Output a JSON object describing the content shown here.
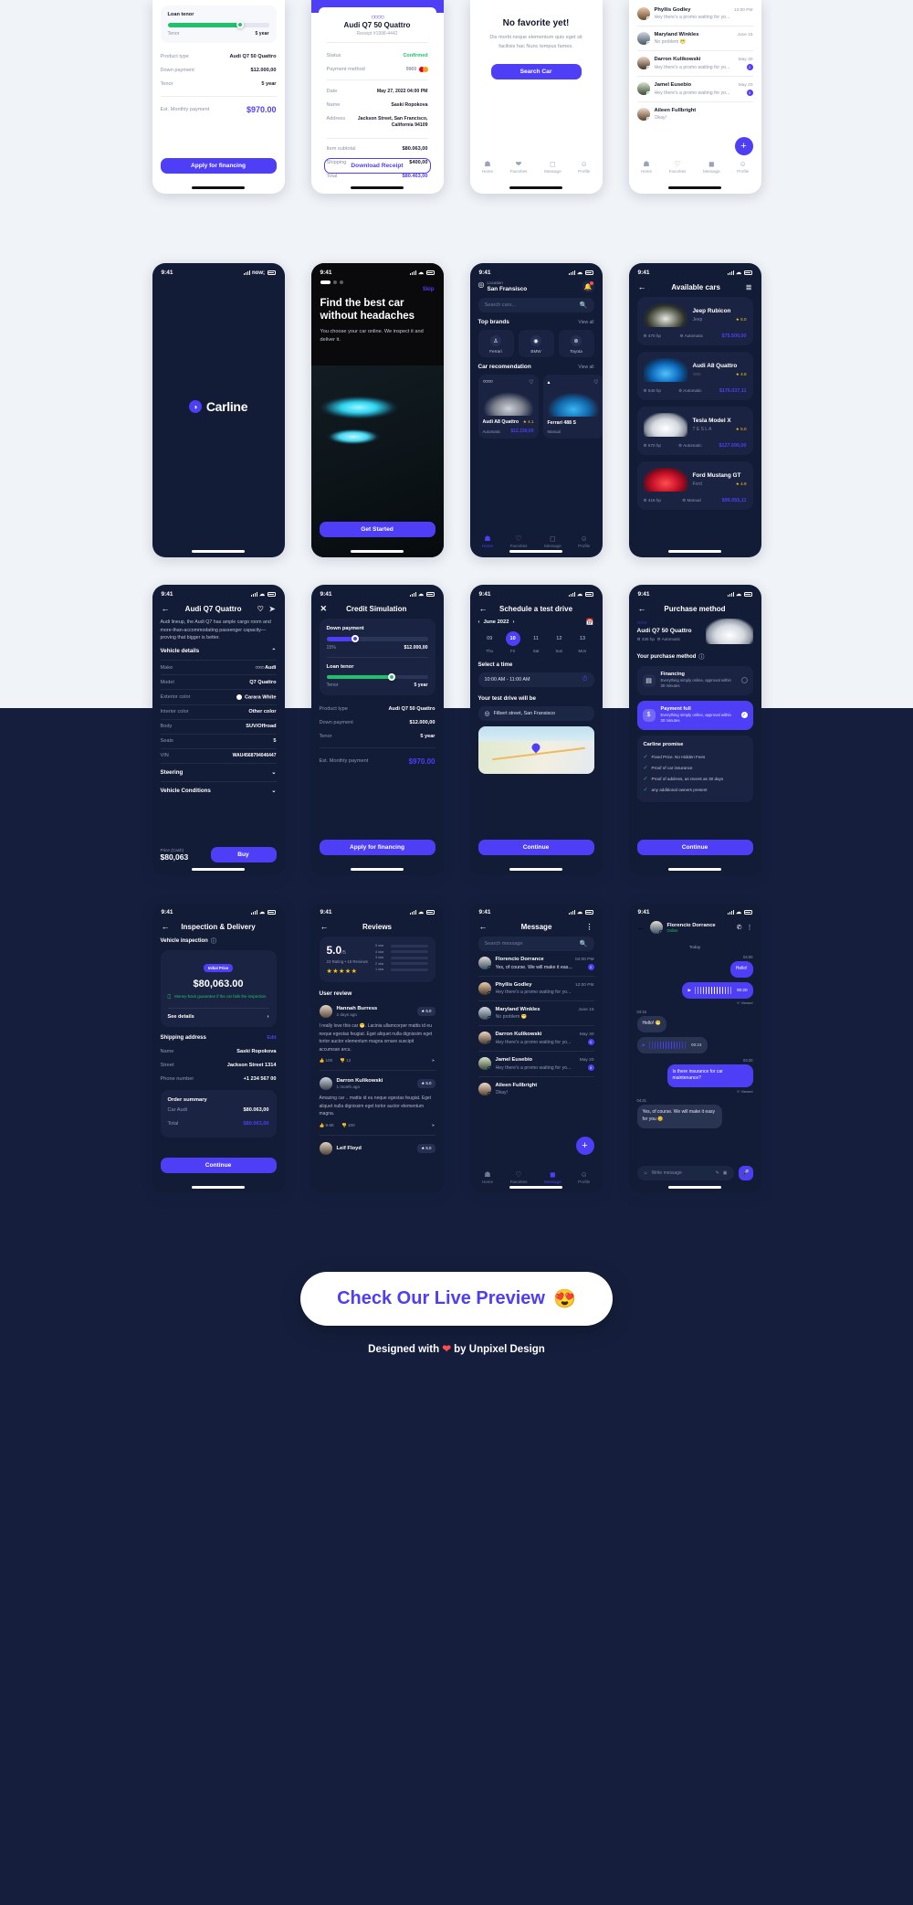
{
  "meta": {
    "status_time": "9:41"
  },
  "brand": {
    "name": "Carline",
    "accent": "#4e3ef5",
    "green": "#1fc16b",
    "gold": "#f5c518"
  },
  "financing": {
    "loan_tenor_label": "Loan tenor",
    "tenor_label": "Tenor",
    "tenor_value": "5 year",
    "rows": [
      {
        "k": "Product type",
        "v": "Audi Q7 50 Quattro"
      },
      {
        "k": "Down payment",
        "v": "$12.000,00"
      },
      {
        "k": "Tenor",
        "v": "5 year"
      }
    ],
    "est_label": "Est. Monthly payment",
    "est_value": "$970.00",
    "cta": "Apply for financing"
  },
  "receipt": {
    "brand_glyph": "\u0000",
    "title": "Audi Q7 50 Quattro",
    "receipt_no": "Receipt #1998-4442",
    "status_label": "Status",
    "status_value": "Confirmed",
    "payment_label": "Payment method",
    "payment_value": "9969",
    "rows": [
      {
        "k": "Date",
        "v": "May 27, 2022 04:00 PM"
      },
      {
        "k": "Name",
        "v": "Saski Ropokova"
      },
      {
        "k": "Address",
        "v": "Jackson Street, San Francisco, California 94109"
      }
    ],
    "totals": [
      {
        "k": "Item subtotal",
        "v": "$80.063,00"
      },
      {
        "k": "Shipping",
        "v": "$400,00"
      },
      {
        "k": "Total",
        "v": "$80.463,00"
      }
    ],
    "cta": "Download Receipt"
  },
  "favorites_empty": {
    "title": "No favorite yet!",
    "body": "Dis morbi neque elementum quis eget sit facilisis hac Nunc tempus fames.",
    "cta": "Search Car"
  },
  "tabbar": {
    "home": "Home",
    "favorites": "Favorites",
    "message": "Message",
    "profile": "Profile"
  },
  "messages": {
    "title": "Message",
    "search_placeholder": "Search message",
    "items": [
      {
        "name": "Florencio Dorrance",
        "time": "04:00 PM",
        "preview": "Yes, of course. We will make it eas...",
        "badge": "2"
      },
      {
        "name": "Phyllis Godley",
        "time": "12:00 PM",
        "preview": "Hey there's a promo waiting for yo...",
        "badge": ""
      },
      {
        "name": "Maryland Winkles",
        "time": "June 15",
        "preview": "No problem 😁",
        "badge": ""
      },
      {
        "name": "Darron Kulikowski",
        "time": "May 30",
        "preview": "Hey there's a promo waiting for yo...",
        "badge": "2"
      },
      {
        "name": "Jamel Eusebio",
        "time": "May 20",
        "preview": "Hey there's a promo waiting for yo...",
        "badge": "3"
      },
      {
        "name": "Aileen Fullbright",
        "time": "",
        "preview": "Okay!",
        "badge": ""
      }
    ],
    "fab": "+"
  },
  "splash": {
    "brand": "Carline",
    "logo_glyph": "◔"
  },
  "onboarding": {
    "skip": "Skip",
    "headline": "Find the best car without headaches",
    "body": "You choose your car online. We inspect it and deliver it.",
    "cta": "Get Started"
  },
  "home": {
    "location_caption": "Location",
    "location_value": "San Fransisco",
    "search_placeholder": "Search cars...",
    "top_brands_title": "Top brands",
    "view_all": "View all",
    "brands": [
      {
        "name": "Ferrari",
        "glyph": "♙"
      },
      {
        "name": "BMW",
        "glyph": "◉"
      },
      {
        "name": "Toyota",
        "glyph": "⊚"
      }
    ],
    "recommendation_title": "Car recomendation",
    "cars": [
      {
        "name": "Audi A8 Quattro",
        "rating": "4.1",
        "transmission": "Automatic",
        "price": "$12.150,00"
      },
      {
        "name": "Ferrari 488 S",
        "rating": "",
        "transmission": "Manual",
        "price": ""
      }
    ]
  },
  "available": {
    "title": "Available cars",
    "cars": [
      {
        "name": "Jeep Rubicon",
        "brand": "Jeep",
        "rating": "5.0",
        "hp": "470 hp",
        "transmission": "Automatic",
        "price": "$75.500,00",
        "thumb": "t-jeep"
      },
      {
        "name": "Audi A8 Quattro",
        "brand": "ⒶⒶⒶⒶ",
        "rating": "4.8",
        "hp": "540 hp",
        "transmission": "Automatic",
        "price": "$176.037,11",
        "thumb": "t-audi"
      },
      {
        "name": "Tesla Model X",
        "brand": "T E S L A",
        "rating": "5.0",
        "hp": "670 hp",
        "transmission": "Automatic",
        "price": "$127.690,00",
        "thumb": "t-tesla"
      },
      {
        "name": "Ford Mustang GT",
        "brand": "Ford",
        "rating": "4.9",
        "hp": "416 hp",
        "transmission": "Manual",
        "price": "$96.055,11",
        "thumb": "t-ford"
      }
    ]
  },
  "detail": {
    "title": "Audi Q7 Quattro",
    "description": "Audi lineup, the Audi Q7 has ample cargo room and more-than-accommodating passenger capacity—proving that bigger is better.",
    "section_vehicle_details": "Vehicle details",
    "specs": [
      {
        "k": "Make",
        "v": "Audi"
      },
      {
        "k": "Model",
        "v": "Q7 Quattro"
      },
      {
        "k": "Exterior color",
        "v": "Carara White"
      },
      {
        "k": "Interior color",
        "v": "Other color"
      },
      {
        "k": "Body",
        "v": "SUV/Offroad"
      },
      {
        "k": "Seats",
        "v": "5"
      },
      {
        "k": "VIN",
        "v": "WAU4568794046447"
      }
    ],
    "section_steering": "Steering",
    "section_conditions": "Vehicle Conditions",
    "price_label": "Price (Cash)",
    "price_value": "$80,063",
    "cta": "Buy"
  },
  "credit": {
    "title": "Credit Simulation",
    "down_payment_label": "Down payment",
    "down_payment_min": "15%",
    "down_payment_value": "$12.000,00",
    "loan_tenor_label": "Loan tenor",
    "tenor_label": "Tenor",
    "tenor_value": "5 year",
    "rows": [
      {
        "k": "Product type",
        "v": "Audi Q7 50 Quattro"
      },
      {
        "k": "Down payment",
        "v": "$12.000,00"
      },
      {
        "k": "Tenor",
        "v": "5 year"
      }
    ],
    "est_label": "Est. Monthly payment",
    "est_value": "$970.00",
    "cta": "Apply for financing"
  },
  "schedule": {
    "title": "Schedule a test drive",
    "month": "June 2022",
    "days": [
      {
        "n": "09",
        "w": "Thu",
        "sel": false
      },
      {
        "n": "10",
        "w": "Fri",
        "sel": true
      },
      {
        "n": "11",
        "w": "Sat",
        "sel": false
      },
      {
        "n": "12",
        "w": "Sun",
        "sel": false
      },
      {
        "n": "13",
        "w": "Mon",
        "sel": false
      }
    ],
    "select_time_label": "Select a time",
    "time_value": "10:00 AM - 11:00 AM",
    "test_drive_label": "Your test drive will be",
    "location_value": "Filbert street, San Fransisco",
    "cta": "Continue"
  },
  "purchase": {
    "title": "Purchase method",
    "car_name": "Audi Q7 50 Quattro",
    "car_hp": "335 hp",
    "car_transmission": "Automatic",
    "method_label": "Your purchase method",
    "options": [
      {
        "t": "Financing",
        "d": "Everything simply online, approval within 30 minutes",
        "sel": false,
        "glyph": "▤"
      },
      {
        "t": "Payment full",
        "d": "Everything simply online, approval within 30 minutes",
        "sel": true,
        "glyph": "$"
      }
    ],
    "promise_title": "Carline promise",
    "promises": [
      "Fixed Price. No Hidden Fees",
      "Proof of car insurance",
      "Proof of address, as recent as 30 days",
      "any additional owners present"
    ],
    "cta": "Continue"
  },
  "inspection": {
    "title": "Inspection & Delivery",
    "section_label": "Vehicle inspection",
    "tag": "Initial Price",
    "amount": "$80,063.00",
    "guarantee": "Money-back guarantee if the car fails the inspection",
    "see_details": "See details",
    "shipping_label": "Shipping address",
    "edit": "Edit",
    "address": [
      {
        "k": "Name",
        "v": "Saski Ropokova"
      },
      {
        "k": "Street",
        "v": "Jackson Street 1314"
      },
      {
        "k": "Phone number",
        "v": "+1 234 567 00"
      }
    ],
    "summary_title": "Order summary",
    "summary": [
      {
        "k": "Car Audi",
        "v": "$80.063,00"
      },
      {
        "k": "Total",
        "v": "$80.063,00"
      }
    ],
    "cta": "Continue"
  },
  "reviews": {
    "title": "Reviews",
    "score": "5.0",
    "score_of": "/5",
    "meta": "23 Rating • 15 Reviews",
    "bars": [
      {
        "label": "5 star",
        "pct": 100
      },
      {
        "label": "4 star",
        "pct": 0
      },
      {
        "label": "3 star",
        "pct": 0
      },
      {
        "label": "2 star",
        "pct": 0
      },
      {
        "label": "1 star",
        "pct": 0
      }
    ],
    "user_review_label": "User review",
    "items": [
      {
        "name": "Hannah Burress",
        "ago": "2 days ago",
        "score": "5.0",
        "text": "I really love this car 😁. Lacinia ullamcorper mattis id eu neque egestas feugiat. Eget aliquet nulla dignissim eget tortor auctor elementum magna ornare suscipit accumsan arcu.",
        "likes": "100",
        "dislikes": "12"
      },
      {
        "name": "Darron Kulikowski",
        "ago": "1 month ago",
        "score": "5.0",
        "text": "Amazing car .. mattis id eu neque egestas feugiat. Eget aliquet nulla dignissim eget tortor auctor elementum magna.",
        "likes": "9.6K",
        "dislikes": "100"
      },
      {
        "name": "Leif Floyd",
        "ago": "",
        "score": "5.0",
        "text": "",
        "likes": "",
        "dislikes": ""
      }
    ]
  },
  "chat": {
    "name": "Florencio Dorrance",
    "status": "Online",
    "day": "Today",
    "bubbles": [
      {
        "side": "me",
        "kind": "text",
        "time": "04:00",
        "text": "Hello!",
        "viewed": ""
      },
      {
        "side": "me",
        "kind": "voice",
        "time": "",
        "text": "00:20",
        "viewed": "Viewed"
      },
      {
        "side": "you",
        "kind": "text",
        "time": "04:15",
        "text": "Hello! 😁",
        "viewed": ""
      },
      {
        "side": "you",
        "kind": "voice",
        "time": "",
        "text": "00:24",
        "viewed": ""
      },
      {
        "side": "me",
        "kind": "text",
        "time": "04:20",
        "text": "Is there insurance for car maintenance?",
        "viewed": "Viewed"
      },
      {
        "side": "you",
        "kind": "text",
        "time": "04:21",
        "text": "Yes, of course. We will make it easy for you 😊",
        "viewed": ""
      }
    ],
    "composer_placeholder": "Write message"
  },
  "cta": {
    "label": "Check Our Live Preview",
    "emoji": "😍"
  },
  "credit_line": {
    "pre": "Designed with ",
    "heart": "❤",
    "post": " by Unpixel Design"
  }
}
